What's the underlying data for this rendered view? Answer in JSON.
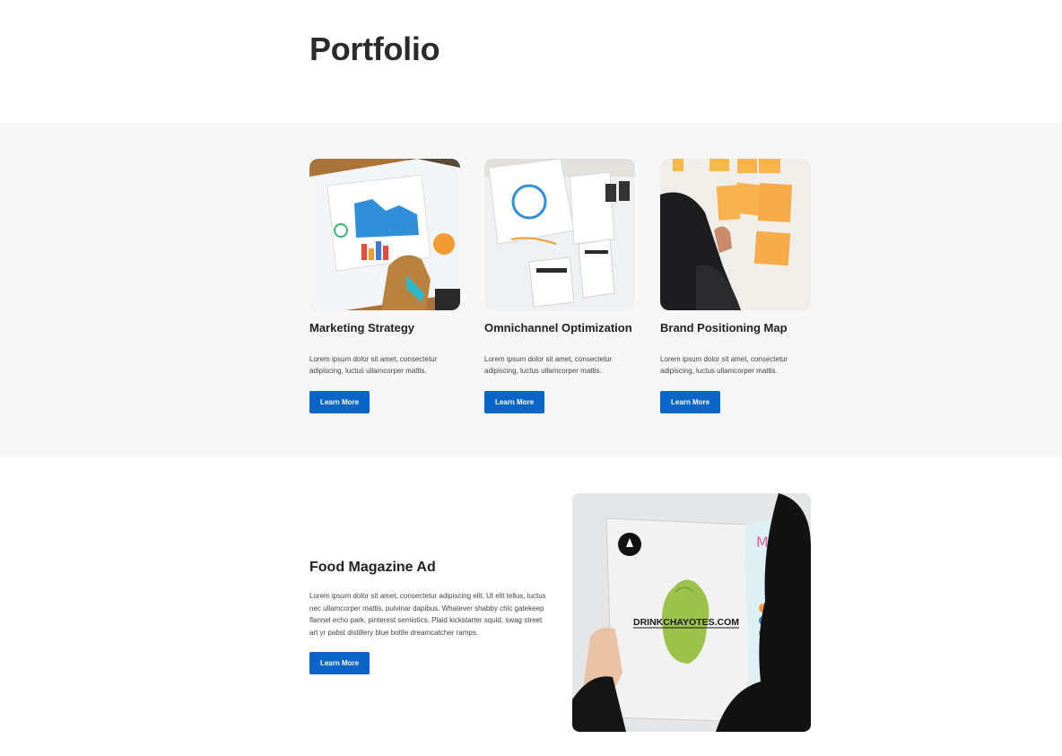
{
  "header": {
    "title": "Portfolio"
  },
  "cards": [
    {
      "title": "Marketing Strategy",
      "text": "Lorem ipsum dolor sit amet, consectetur adipiscing, luctus ullamcorper mattis.",
      "button": "Learn More"
    },
    {
      "title": "Omnichannel Optimization",
      "text": "Lorem ipsum dolor sit amet, consectetur adipiscing, luctus ullamcorper mattis.",
      "button": "Learn More"
    },
    {
      "title": "Brand Positioning Map",
      "text": "Lorem ipsum dolor sit amet, consectetur adipiscing, luctus ullamcorper mattis.",
      "button": "Learn More"
    }
  ],
  "feature": {
    "title": "Food Magazine Ad",
    "text": "Lorem ipsum dolor sit amet, consectetur adipiscing elit. Ut elit tellus, luctus nec ullamcorper mattis, pulvinar dapibus. Whatever shabby chic gatekeep flannel echo park, pinterest semiotics. Plaid kickstarter squid, swag street art yr pabst distillery blue bottle dreamcatcher ramps.",
    "button": "Learn More",
    "image_text": "DRINKCHAYOTES.COM"
  },
  "colors": {
    "accent": "#0a65c8",
    "band": "#f7f7f7"
  }
}
